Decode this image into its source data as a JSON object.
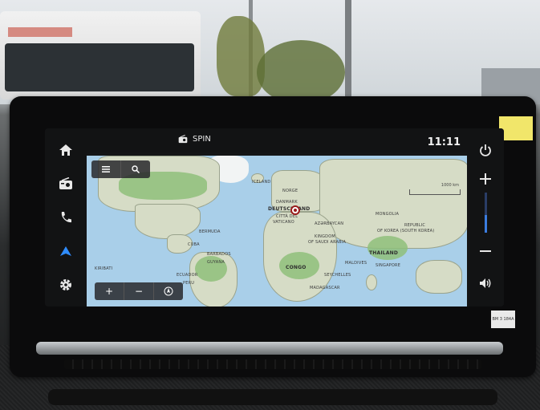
{
  "topbar": {
    "source_icon": "radio-icon",
    "source_label": "SPIN",
    "clock": "11:11"
  },
  "left_rail": [
    {
      "id": "home",
      "icon": "home-icon"
    },
    {
      "id": "radio",
      "icon": "radio-icon"
    },
    {
      "id": "phone",
      "icon": "phone-icon"
    },
    {
      "id": "navigation",
      "icon": "navigation-arrow-icon",
      "active": true
    },
    {
      "id": "settings",
      "icon": "gear-icon"
    }
  ],
  "right_rail": [
    {
      "id": "power",
      "icon": "power-icon"
    },
    {
      "id": "volume_up",
      "icon": "plus-icon"
    },
    {
      "id": "volume_down",
      "icon": "minus-icon"
    },
    {
      "id": "volume",
      "icon": "speaker-icon"
    }
  ],
  "volume_level": 0.45,
  "map": {
    "top_controls": [
      {
        "id": "menu",
        "icon": "menu-icon"
      },
      {
        "id": "search",
        "icon": "search-icon"
      }
    ],
    "bottom_controls": [
      {
        "id": "zoom_in",
        "label": "+"
      },
      {
        "id": "zoom_out",
        "label": "−"
      },
      {
        "id": "compass",
        "icon": "compass-icon"
      }
    ],
    "scale_label": "1000 km",
    "labels": {
      "iceland": "ICELAND",
      "norge": "NORGE",
      "danmark": "DANMARK",
      "deutschland": "DEUTSCHLAND",
      "citta": "CITTÀ DEL",
      "vaticano": "VATICANO",
      "azerbaijan": "AZƏRBAYCAN",
      "mongolia": "MONGOLIA",
      "bermuda": "BERMUDA",
      "cuba": "CUBA",
      "barbados": "BARBADOS",
      "guyana": "GUYANA",
      "kingdom": "KINGDOM",
      "saudi": "OF SAUDI ARABIA",
      "republic": "REPUBLIC",
      "korea": "OF KOREA (SOUTH KOREA)",
      "thailand": "THAILAND",
      "congo": "CONGO",
      "maldives": "MALDIVES",
      "singapore": "SINGAPORE",
      "seychelles": "SEYCHELLES",
      "madagascar": "MADAGASCAR",
      "ecuador": "ECUADOR",
      "peru": "PERU",
      "kiribati": "KIRIBATI"
    }
  },
  "badge": "BM 3 184A"
}
